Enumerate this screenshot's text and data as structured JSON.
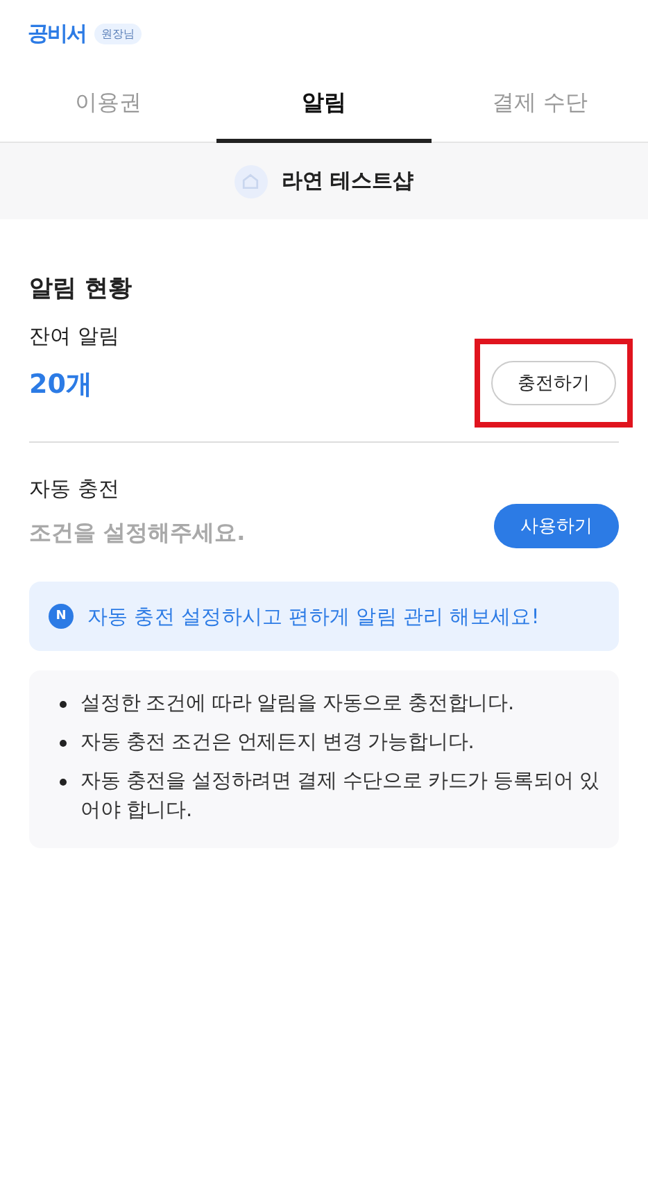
{
  "header": {
    "logo": "공비서",
    "role_badge": "원장님"
  },
  "tabs": [
    {
      "label": "이용권",
      "selected": false
    },
    {
      "label": "알림",
      "selected": true
    },
    {
      "label": "결제 수단",
      "selected": false
    }
  ],
  "shop": {
    "name": "라연 테스트샵"
  },
  "section_title": "알림 현황",
  "remaining": {
    "label": "잔여 알림",
    "value": "20개",
    "button": "충전하기",
    "highlighted": true
  },
  "auto_charge": {
    "label": "자동 충전",
    "condition": "조건을 설정해주세요.",
    "button": "사용하기"
  },
  "notice": {
    "badge": "N",
    "text": "자동 충전 설정하시고 편하게 알림 관리 해보세요!"
  },
  "info": [
    "설정한 조건에 따라 알림을 자동으로 충전합니다.",
    "자동 충전 조건은 언제든지 변경 가능합니다.",
    "자동 충전을 설정하려면 결제 수단으로 카드가 등록되어 있어야 합니다."
  ]
}
